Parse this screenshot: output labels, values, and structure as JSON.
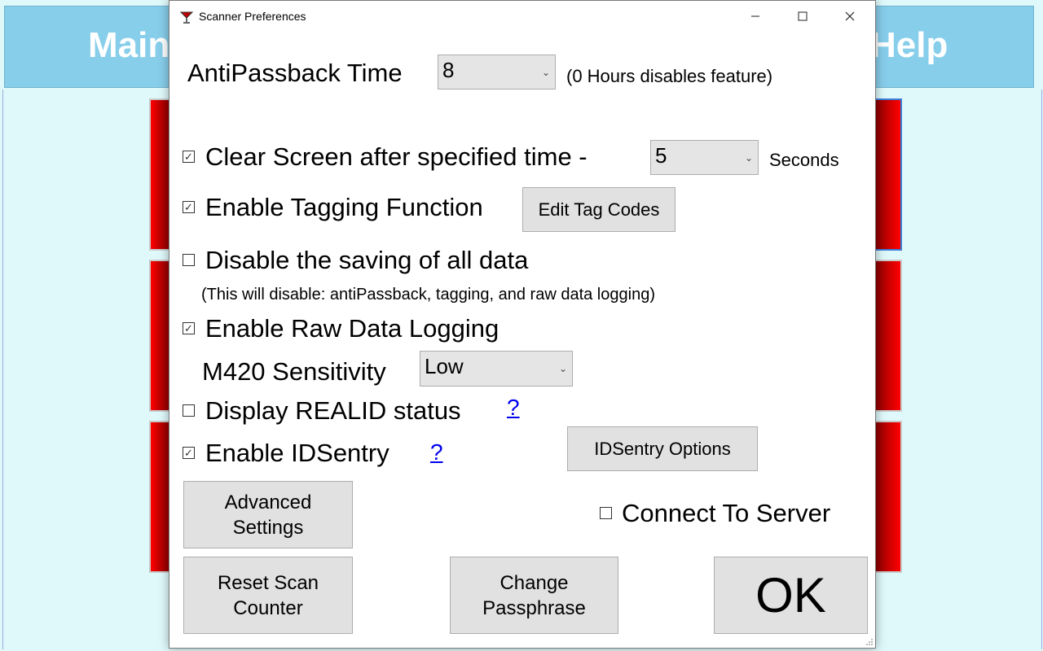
{
  "background": {
    "header_left": "Main",
    "header_right": "Help"
  },
  "dialog": {
    "title": "Scanner Preferences",
    "antipassback": {
      "label": "AntiPassback Time",
      "value": "8",
      "hint": "(0 Hours disables feature)"
    },
    "clear_screen": {
      "label": "Clear Screen after specified time -",
      "checked": true,
      "value": "5",
      "unit": "Seconds"
    },
    "tagging": {
      "label": "Enable Tagging Function",
      "checked": true,
      "button": "Edit Tag Codes"
    },
    "disable_saving": {
      "label": "Disable the saving of all data",
      "checked": false,
      "note": "(This will disable: antiPassback, tagging, and raw data logging)"
    },
    "raw_logging": {
      "label": "Enable Raw Data Logging",
      "checked": true
    },
    "sensitivity": {
      "label": "M420 Sensitivity",
      "value": "Low"
    },
    "realid": {
      "label": "Display REALID status",
      "checked": false,
      "help": "?"
    },
    "idsentry": {
      "label": "Enable IDSentry",
      "checked": true,
      "help": "?",
      "button": "IDSentry Options"
    },
    "connect_server": {
      "label": "Connect To Server",
      "checked": false
    },
    "buttons": {
      "advanced_l1": "Advanced",
      "advanced_l2": "Settings",
      "reset_l1": "Reset Scan",
      "reset_l2": "Counter",
      "change_l1": "Change",
      "change_l2": "Passphrase",
      "ok": "OK"
    }
  }
}
